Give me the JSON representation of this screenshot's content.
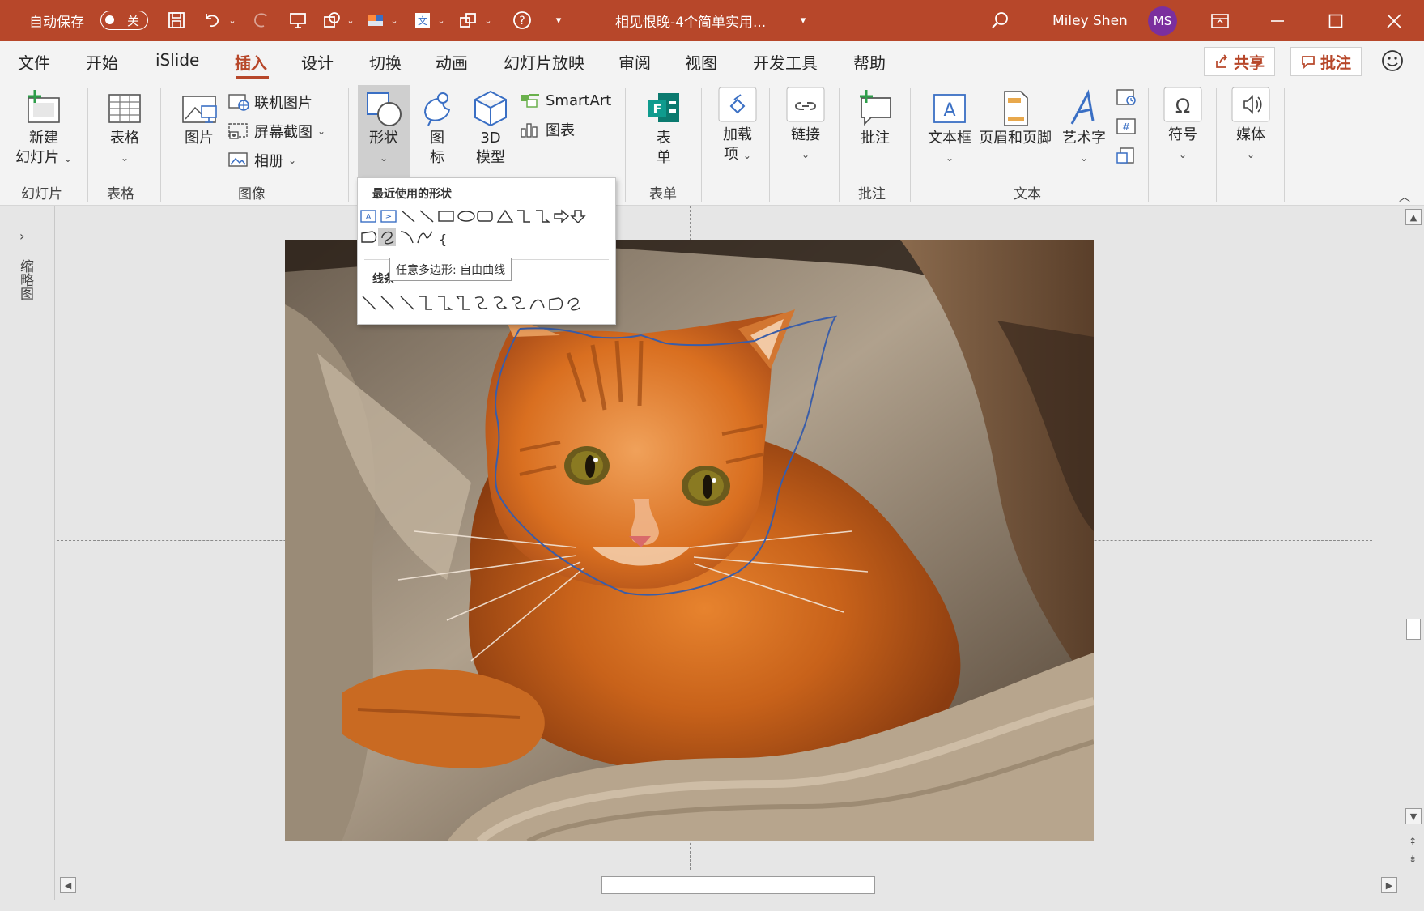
{
  "titlebar": {
    "autosave_label": "自动保存",
    "autosave_state": "关",
    "doc_title": "相见恨晚-4个简单实用...",
    "user_name": "Miley Shen",
    "user_initials": "MS",
    "color": "#b7472a"
  },
  "menu": {
    "tabs": [
      "文件",
      "开始",
      "iSlide",
      "插入",
      "设计",
      "切换",
      "动画",
      "幻灯片放映",
      "审阅",
      "视图",
      "开发工具",
      "帮助"
    ],
    "active_tab": "插入",
    "share_label": "共享",
    "comment_label": "批注"
  },
  "ribbon": {
    "new_slide_label_1": "新建",
    "new_slide_label_2": "幻灯片",
    "table_label": "表格",
    "picture_label": "图片",
    "online_picture_label": "联机图片",
    "screenshot_label": "屏幕截图",
    "album_label": "相册",
    "shapes_label": "形状",
    "icons_label_1": "图",
    "icons_label_2": "标",
    "model3d_label_1": "3D",
    "model3d_label_2": "模型",
    "smartart_label": "SmartArt",
    "chart_label": "图表",
    "forms_label_1": "表",
    "forms_label_2": "单",
    "addins_label_1": "加载",
    "addins_label_2": "项",
    "link_label": "链接",
    "comment_label": "批注",
    "textbox_label": "文本框",
    "header_footer_label": "页眉和页脚",
    "wordart_label": "艺术字",
    "symbol_label": "符号",
    "media_label": "媒体",
    "groups": {
      "slides": "幻灯片",
      "tables": "表格",
      "images": "图像",
      "forms": "表单",
      "comments": "批注",
      "text": "文本"
    }
  },
  "shapes_dropdown": {
    "recent_heading": "最近使用的形状",
    "lines_heading": "线条",
    "tooltip": "任意多边形: 自由曲线"
  },
  "left_pane": {
    "label": "缩略图"
  },
  "slide": {
    "image_subject": "orange tabby cat on beige blanket"
  }
}
